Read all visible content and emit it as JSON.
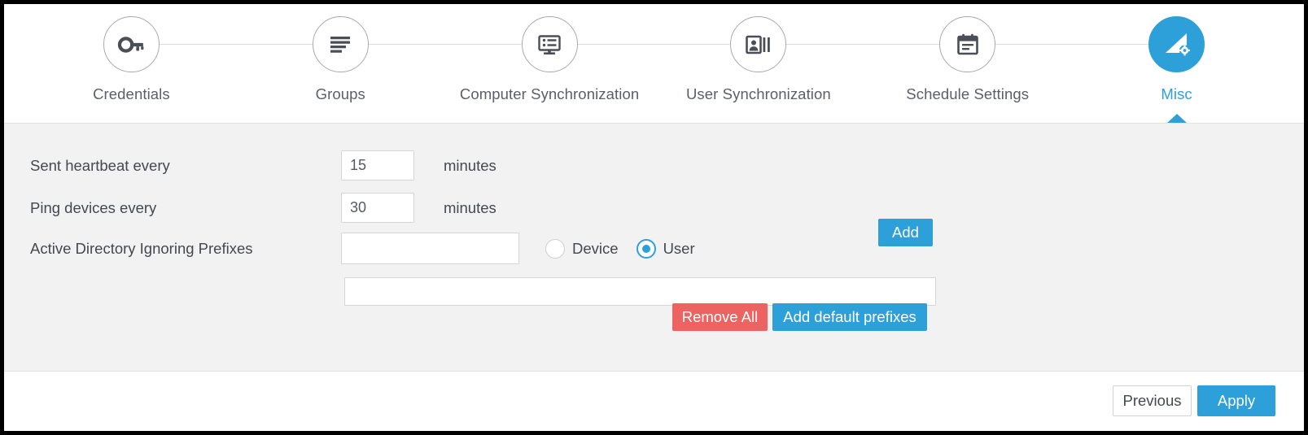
{
  "theme": {
    "accent": "#2ea0d9",
    "danger": "#ed6362",
    "panel_bg": "#f2f2f2",
    "label_color": "#44484f",
    "step_label_color": "#5a5f6a"
  },
  "stepper": {
    "steps": [
      {
        "label": "Credentials",
        "icon": "key-icon",
        "active": false
      },
      {
        "label": "Groups",
        "icon": "align-left-icon",
        "active": false
      },
      {
        "label": "Computer Synchronization",
        "icon": "monitor-list-icon",
        "active": false
      },
      {
        "label": "User Synchronization",
        "icon": "id-card-icon",
        "active": false
      },
      {
        "label": "Schedule Settings",
        "icon": "calendar-icon",
        "active": false
      },
      {
        "label": "Misc",
        "icon": "ruler-gear-icon",
        "active": true
      }
    ]
  },
  "form": {
    "heartbeat": {
      "label": "Sent heartbeat every",
      "value": "15",
      "placeholder": "",
      "unit": "minutes"
    },
    "ping": {
      "label": "Ping devices every",
      "value": "30",
      "placeholder": "",
      "unit": "minutes"
    },
    "prefixes": {
      "label": "Active Directory Ignoring Prefixes",
      "input_value": "",
      "input_placeholder": "",
      "list_value": "",
      "list_placeholder": "",
      "radios": [
        {
          "label": "Device",
          "checked": false
        },
        {
          "label": "User",
          "checked": true
        }
      ],
      "add_label": "Add",
      "remove_all_label": "Remove All",
      "add_defaults_label": "Add default prefixes"
    }
  },
  "footer": {
    "previous_label": "Previous",
    "apply_label": "Apply"
  }
}
